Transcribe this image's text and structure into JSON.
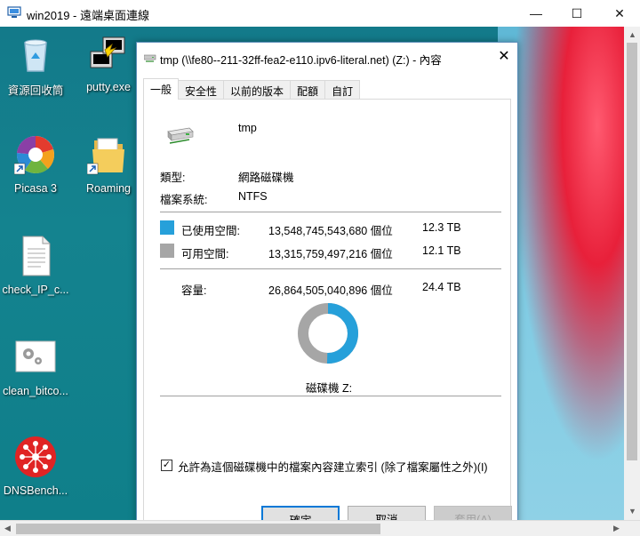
{
  "rdp": {
    "title": "win2019 - 遠端桌面連線",
    "minimize": "—",
    "maximize": "☐",
    "close": "✕"
  },
  "desktop_icons": [
    {
      "label": "資源回收筒",
      "icon": "recycle-bin-icon"
    },
    {
      "label": "putty.exe",
      "icon": "putty-icon"
    },
    {
      "label": "Picasa 3",
      "icon": "picasa-icon"
    },
    {
      "label": "Roaming",
      "icon": "folder-icon"
    },
    {
      "label": "check_IP_c...",
      "icon": "text-file-icon"
    },
    {
      "label": "clean_bitco...",
      "icon": "settings-file-icon"
    },
    {
      "label": "DNSBench...",
      "icon": "dnsbench-icon"
    }
  ],
  "dialog": {
    "title": "tmp (\\\\fe80--211-32ff-fea2-e110.ipv6-literal.net) (Z:) - 內容",
    "close": "✕",
    "tabs": [
      "一般",
      "安全性",
      "以前的版本",
      "配額",
      "自訂"
    ],
    "active_tab": "一般",
    "name": "tmp",
    "type_label": "類型:",
    "type_value": "網路磁碟機",
    "fs_label": "檔案系統:",
    "fs_value": "NTFS",
    "used_label": "已使用空間:",
    "used_bytes": "13,548,745,543,680 個位",
    "used_size": "12.3 TB",
    "free_label": "可用空間:",
    "free_bytes": "13,315,759,497,216 個位",
    "free_size": "12.1 TB",
    "cap_label": "容量:",
    "cap_bytes": "26,864,505,040,896 個位",
    "cap_size": "24.4 TB",
    "drive_label": "磁碟機 Z:",
    "index_checkbox": "允許為這個磁碟機中的檔案內容建立索引 (除了檔案屬性之外)(I)",
    "index_checked": true,
    "ok": "確定",
    "cancel": "取消",
    "apply": "套用(A)",
    "used_fraction": 0.5043,
    "colors": {
      "used": "#26a0da",
      "free": "#a6a6a6"
    }
  }
}
